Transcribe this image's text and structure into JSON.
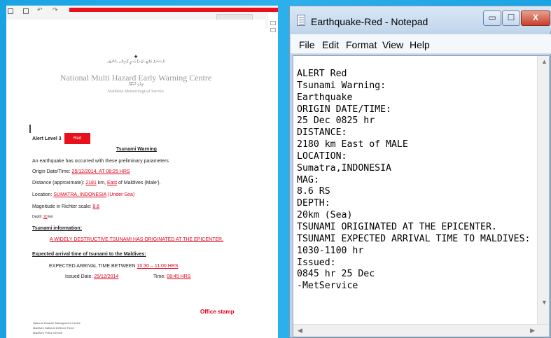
{
  "document": {
    "header_script_line1": "ނެޝަނަލް މަލްޓި ހަޒަރޑް އަރލީ ވޯނިންގ ސެންޓަރ",
    "centre_name": "National Multi Hazard Early Warning Centre",
    "header_script_line2": "ދިވެހި ރާއްޖޭގެ",
    "service_name": "Maldives Meteorological Service",
    "alert_level_label": "Alert Level 3",
    "alert_level_value": "Red",
    "heading": "Tsunami Warning",
    "intro": "An earthquake has occurred with these preliminary parameters",
    "origin_label": "Origin Date/Time:",
    "origin_value": "25/12/2014, AT 08:25 HRS",
    "distance_label": "Distance (approximate):",
    "distance_value": "2181",
    "distance_km": "km,",
    "distance_dir": "East",
    "distance_suffix": "of Maldives (Male').",
    "location_label": "Location:",
    "location_value": "SUMATRA, INDONESIA",
    "location_suffix": "(Under Sea)",
    "magnitude_label": "Magnitude in Richter scale:",
    "magnitude_value": "8.6",
    "depth_label": "Depth:",
    "depth_value": "20",
    "depth_unit": "km",
    "tsunami_info_heading": "Tsunami information:",
    "tsunami_info_text": "A WIDELY DESTRUCTIVE TSUNAMI HAS ORIGINATED AT THE EPICENTER.",
    "arrival_heading": "Expected arrival time of tsunami to the Maldives:",
    "arrival_label": "EXPECTED ARRIVAL TIME BETWEEN",
    "arrival_value": "10:30 – 11:00 HRS",
    "issued_label": "Issued Date:",
    "issued_date": "25/12/2014",
    "time_label": "Time:",
    "issued_time": "08:45 HRS",
    "office_stamp": "Office stamp",
    "footer": [
      "National Disaster Management Centre",
      "Maldives National Defence Force",
      "Maldives Police Service"
    ]
  },
  "notepad": {
    "title": "Earthquake-Red - Notepad",
    "buttons": {
      "minimize": "▭",
      "maximize": "☐",
      "close": "X"
    },
    "menu": [
      "File",
      "Edit",
      "Format",
      "View",
      "Help"
    ],
    "lines": [
      "ALERT Red",
      "Tsunami Warning:",
      "Earthquake",
      "ORIGIN DATE/TIME:",
      "25 Dec 0825 hr",
      "DISTANCE:",
      "2180 km East of MALE",
      "LOCATION:",
      "Sumatra,INDONESIA",
      "MAG:",
      "8.6 RS",
      "DEPTH:",
      "20km (Sea)",
      "TSUNAMI ORIGINATED AT THE EPICENTER.",
      "TSUNAMI EXPECTED ARRIVAL TIME TO MALDIVES:",
      "1030-1100 hr",
      "Issued:",
      "0845 hr 25 Dec",
      "-MetService"
    ]
  }
}
